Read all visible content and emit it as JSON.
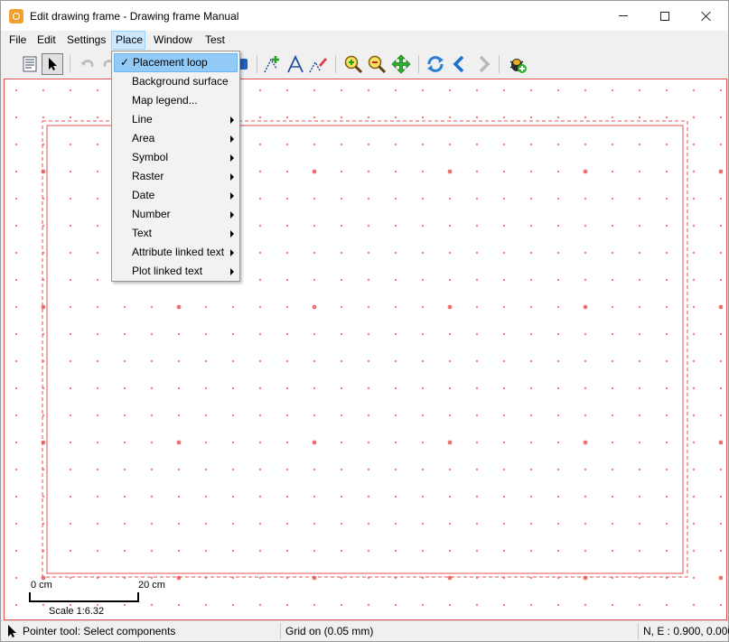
{
  "window": {
    "title": "Edit drawing frame - Drawing frame Manual",
    "controls": {
      "minimize": "minimize-icon",
      "maximize": "maximize-icon",
      "close": "close-icon"
    }
  },
  "menubar": {
    "items": [
      {
        "label": "File",
        "mnemonic": "F"
      },
      {
        "label": "Edit",
        "mnemonic": "E"
      },
      {
        "label": "Settings",
        "mnemonic": "S"
      },
      {
        "label": "Place",
        "mnemonic": "P",
        "active": true
      },
      {
        "label": "Window",
        "mnemonic": "W"
      },
      {
        "label": "Test",
        "mnemonic": "T"
      }
    ]
  },
  "place_menu": {
    "items": [
      {
        "label": "Placement loop",
        "checked": true,
        "highlighted": true,
        "submenu": false
      },
      {
        "label": "Background surface",
        "submenu": false
      },
      {
        "label": "Map legend...",
        "submenu": false
      },
      {
        "label": "Line",
        "submenu": true
      },
      {
        "label": "Area",
        "submenu": true
      },
      {
        "label": "Symbol",
        "submenu": true
      },
      {
        "label": "Raster",
        "submenu": true
      },
      {
        "label": "Date",
        "submenu": true
      },
      {
        "label": "Number",
        "submenu": true
      },
      {
        "label": "Text",
        "submenu": true
      },
      {
        "label": "Attribute linked text",
        "submenu": true
      },
      {
        "label": "Plot linked text",
        "submenu": true
      }
    ]
  },
  "toolbar": {
    "icons": [
      "properties-icon",
      "pointer-icon",
      "undo-icon",
      "redo-icon",
      "object-icon",
      "add-line-point-icon",
      "text-tool-icon",
      "edit-text-icon",
      "zoom-in-icon",
      "zoom-out-icon",
      "pan-icon",
      "refresh-icon",
      "back-icon",
      "forward-icon",
      "test-bug-icon"
    ]
  },
  "canvas": {
    "scale": {
      "start_label": "0 cm",
      "end_label": "20 cm",
      "scale_text": "Scale 1:6.32"
    },
    "colors": {
      "frame": "#e05050",
      "dots": "#f08080",
      "major_dots": "#ee7070"
    }
  },
  "statusbar": {
    "tool": "Pointer tool: Select components",
    "grid": "Grid on (0.05 mm)",
    "coords": "N, E : 0.900, 0.000"
  }
}
